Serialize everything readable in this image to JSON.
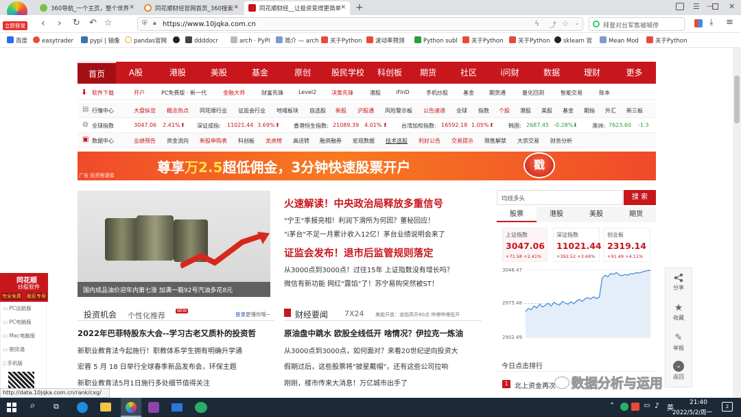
{
  "browser": {
    "login_badge": "立即登录",
    "tabs": [
      {
        "label": "360导航_一个主页，整个世界",
        "close": "✕",
        "icon_color": "#7bc043"
      },
      {
        "label": "同花顺财经官网首页_360搜索",
        "close": "✕",
        "icon_color": "#e08a2a"
      },
      {
        "label": "同花顺财经__让投资变得更简单",
        "close": "✕",
        "icon_color": "#c8161d"
      }
    ],
    "new_tab": "+",
    "url": "https://www.10jqka.com.cn",
    "search_box": "拜登对台军售被喊停",
    "bookmarks": [
      "百度",
      "easytrader",
      "pypi | 镜像",
      "pandas官网",
      "",
      "ddddocr",
      "arch · PyPI",
      "简介 — arch",
      "关于Python",
      "波动率预测",
      "Python subl",
      "关于Python",
      "关于Python",
      "sklearn 官",
      "Mean Mod",
      "关于Python"
    ],
    "status_url": "http://data.10jqka.com.cn/rank/cxg/"
  },
  "site": {
    "main_nav": [
      "首页",
      "A股",
      "港股",
      "美股",
      "基金",
      "原创",
      "股民学校",
      "科创板",
      "期货",
      "社区",
      "i问财",
      "数据",
      "理财",
      "更多"
    ],
    "row1": {
      "label": "软件下载",
      "items": [
        "开户",
        "PC免费版 · 新一代",
        "金融大师",
        "财富先锋",
        "Level2",
        "决策先锋",
        "港股",
        "iFinD",
        "手机炒股",
        "基金",
        "期货通",
        "量化回测",
        "智能交易",
        "账本"
      ],
      "red_items": [
        "金融大师",
        "决策先锋"
      ]
    },
    "row2": {
      "label": "行情中心",
      "items": [
        "大盘纵览",
        "概念热点",
        "同花顺行业",
        "证监会行业",
        "地域板块",
        "自选股",
        "新股",
        "沪股通",
        "风险警示板",
        "公告速递",
        "全球",
        "指数",
        "个股",
        "港股",
        "美股",
        "基金",
        "期指",
        "外汇",
        "新三板"
      ],
      "red_items": [
        "大盘纵览",
        "概念热点",
        "新股",
        "沪股通",
        "公告速递",
        "个股"
      ]
    },
    "row3": {
      "label": "全球指数",
      "items": [
        {
          "name": "",
          "value": "3047.06",
          "change": "2.41%",
          "dir": "up"
        },
        {
          "name": "深证成指:",
          "value": "11021.44",
          "change": "3.69%",
          "dir": "up"
        },
        {
          "name": "香港恒生指数:",
          "value": "21089.39",
          "change": "4.01%",
          "dir": "up"
        },
        {
          "name": "台湾加权指数:",
          "value": "16592.18",
          "change": "1.05%",
          "dir": "up"
        },
        {
          "name": "韩国:",
          "value": "2687.45",
          "change": "-0.28%",
          "dir": "down"
        },
        {
          "name": "澳洲:",
          "value": "7623.60",
          "change": "-1.3",
          "dir": "down"
        }
      ]
    },
    "row4": {
      "label": "数据中心",
      "items": [
        "业绩预告",
        "资金流向",
        "新股申购表",
        "科创板",
        "龙虎榜",
        "高送转",
        "融资融券",
        "宏观数据",
        "技术选股",
        "利好公告",
        "交易提示",
        "限售解禁",
        "大宗交易",
        "财务分析"
      ],
      "red_items": [
        "新股申购表",
        "龙虎榜",
        "利好公告",
        "交易提示"
      ]
    },
    "banner": {
      "text_pre": "尊享",
      "highlight": "万2.5",
      "text_post": "超低佣金，3分钟快速股票开户",
      "button": "戳",
      "ad_note": "广告  投资需谨慎"
    },
    "hero_caption": "国内成品油价迎年内第七涨 加满一箱92号汽油多花8元",
    "headlines": [
      {
        "title": "火速解读！中央政治局释放多重信号",
        "subs": [
          "\"宁王\"季报亮相！利润下滑所为何因？董秘回应！",
          "\"i茅台\"不足一月累计收入12亿！茅台业绩说明会来了"
        ]
      },
      {
        "title": "证监会发布！退市后监管规则落定",
        "subs": [
          "从3000点到3000点！过往15年 上证指数没有增长吗？",
          "微信有新功能 网红\"露馅\"了！苏宁易购突然被ST！"
        ]
      }
    ],
    "invest": {
      "tab1": "投资机会",
      "tab2": "个性化推荐",
      "new_badge": "NEW",
      "login_text": "登录",
      "login_suffix": "更懂你哦~",
      "items": [
        "2022年巴菲特股东大会--学习古老又质朴的投资哲",
        "新职业教育法今起施行！职教体系学生拥有明确升学通",
        "宏蓉 5 月 18 日举行全球春季新品发布会，环保主题",
        "新职业教育法5月1日施行多处细节值得关注"
      ]
    },
    "finance": {
      "tab1": "财经要闻",
      "tab2": "7X24",
      "ticker": "美股开盘：道指高开80点 哔哩哔哩低开",
      "items": [
        "原油盘中跳水 欧股全线低开 啥情况？伊拉克一炼油",
        "从3000点到3000点，如何面对？来看20世纪逆向投资大",
        "假期过后，这些股票将\"披星戴帽\"，还有这些公司拉响",
        "刚刚，楼市传来大消息！万亿城市出手了"
      ]
    },
    "search": {
      "placeholder": "均线多头",
      "button": "搜 索"
    },
    "market_tabs": [
      "股票",
      "港股",
      "美股",
      "期货"
    ],
    "indices": [
      {
        "name": "上证指数",
        "value": "3047.06",
        "change": "+71.58 +2.41%"
      },
      {
        "name": "深证指数",
        "value": "11021.44",
        "change": "+392.52 +3.69%"
      },
      {
        "name": "创业板",
        "value": "2319.14",
        "change": "+91.49 +4.11%"
      }
    ],
    "chart": {
      "y_ticks": [
        "3048.47",
        "2975.48",
        "2902.49"
      ],
      "values": [
        2958,
        2965,
        2962,
        2970,
        2966,
        2974,
        2968,
        2972,
        2976,
        2970,
        2978,
        2974,
        2972,
        2980,
        2976,
        2974,
        2979,
        2975,
        2981,
        2984,
        2980,
        2986,
        2988,
        2985,
        2990,
        2986,
        2989,
        3030,
        3036,
        3033,
        3040,
        3038,
        3042,
        3037,
        3035,
        3038,
        3036,
        3040,
        3039,
        3042,
        3041,
        3043,
        3045,
        3046,
        3047
      ]
    },
    "hot_title": "今日点击排行",
    "hot_first": {
      "rank": "1",
      "text": "北上资金再次"
    },
    "right_sidebar": [
      "分享",
      "收藏",
      "举报",
      "返回"
    ],
    "left_ad": {
      "brand": "同花顺",
      "sub": "炒股软件",
      "tag1": "完全免费",
      "tag2": "股民专用"
    },
    "left_sidebar": [
      "PC远航版",
      "PC电脑版",
      "Mac电脑版",
      "期货通",
      "手机版"
    ],
    "watermark": "数据分析与运用"
  },
  "taskbar": {
    "time": "21:40",
    "date": "2022/5/2/周一",
    "lang": "英",
    "notif": "2"
  }
}
